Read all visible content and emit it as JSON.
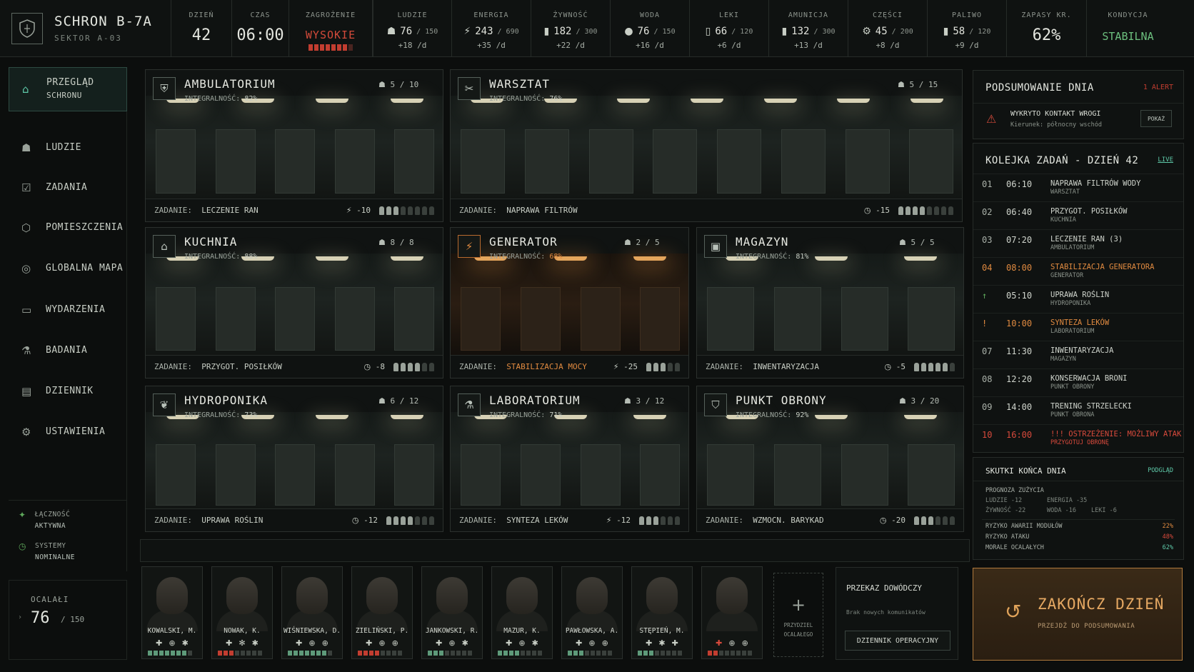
{
  "brand": {
    "title": "SCHRON B-7A",
    "sub": "SEKTOR A-03"
  },
  "top": {
    "day": {
      "label": "DZIEŃ",
      "value": "42"
    },
    "time": {
      "label": "CZAS",
      "value": "06:00"
    },
    "threat": {
      "label": "ZAGROŻENIE",
      "value": "WYSOKIE",
      "level": 7,
      "max": 8
    },
    "resources": [
      {
        "label": "LUDZIE",
        "icon": "people-icon",
        "value": "76",
        "max": "/ 150",
        "delta": "+18 /d"
      },
      {
        "label": "ENERGIA",
        "icon": "bolt-icon",
        "value": "243",
        "max": "/ 690",
        "delta": "+35 /d"
      },
      {
        "label": "ŻYWNOŚĆ",
        "icon": "food-icon",
        "value": "182",
        "max": "/ 300",
        "delta": "+22 /d"
      },
      {
        "label": "WODA",
        "icon": "water-icon",
        "value": "76",
        "max": "/ 150",
        "delta": "+16 /d"
      },
      {
        "label": "LEKI",
        "icon": "medicine-icon",
        "value": "66",
        "max": "/ 120",
        "delta": "+6 /d"
      },
      {
        "label": "AMUNICJA",
        "icon": "ammo-icon",
        "value": "132",
        "max": "/ 300",
        "delta": "+13 /d"
      },
      {
        "label": "CZĘŚCI",
        "icon": "gear-icon",
        "value": "45",
        "max": "/ 200",
        "delta": "+8 /d"
      },
      {
        "label": "PALIWO",
        "icon": "fuel-icon",
        "value": "58",
        "max": "/ 120",
        "delta": "+9 /d"
      }
    ],
    "supplies": {
      "label": "ZAPASY KR.",
      "value": "62%"
    },
    "condition": {
      "label": "KONDYCJA",
      "value": "STABILNA"
    }
  },
  "nav": [
    {
      "label": "PRZEGLĄD",
      "label2": "SCHRONU",
      "icon": "home-icon",
      "active": true
    },
    {
      "label": "LUDZIE",
      "icon": "people-icon"
    },
    {
      "label": "ZADANIA",
      "icon": "tasks-icon"
    },
    {
      "label": "POMIESZCZENIA",
      "icon": "rooms-icon"
    },
    {
      "label": "GLOBALNA MAPA",
      "icon": "globe-icon"
    },
    {
      "label": "WYDARZENIA",
      "icon": "book-icon"
    },
    {
      "label": "BADANIA",
      "icon": "flask-icon"
    },
    {
      "label": "DZIENNIK",
      "icon": "log-icon"
    },
    {
      "label": "USTAWIENIA",
      "icon": "settings-icon"
    }
  ],
  "status": [
    {
      "l1": "ŁĄCZNOŚĆ",
      "l2": "AKTYWNA"
    },
    {
      "l1": "SYSTEMY",
      "l2": "NOMINALNE"
    }
  ],
  "survivors": {
    "label": "OCALAŁI",
    "value": "76",
    "max": "/ 150"
  },
  "rooms": [
    {
      "name": "AMBULATORIUM",
      "integrity_label": "INTEGRALNOŚĆ:",
      "integrity": "82%",
      "crew": "5 / 10",
      "task_label": "ZADANIE:",
      "task": "LECZENIE RAN",
      "cost": "-10",
      "cost_icon": "bolt-icon",
      "pips": 3,
      "pips_max": 8
    },
    {
      "name": "WARSZTAT",
      "integrity_label": "INTEGRALNOŚĆ:",
      "integrity": "76%",
      "crew": "5 / 15",
      "task_label": "ZADANIE:",
      "task": "NAPRAWA FILTRÓW",
      "cost": "-15",
      "cost_icon": "clock-icon",
      "pips": 4,
      "pips_max": 8
    },
    {
      "name": "KUCHNIA",
      "integrity_label": "INTEGRALNOŚĆ:",
      "integrity": "88%",
      "crew": "8 / 8",
      "task_label": "ZADANIE:",
      "task": "PRZYGOT. POSIŁKÓW",
      "cost": "-8",
      "cost_icon": "clock-icon",
      "pips": 4,
      "pips_max": 6
    },
    {
      "name": "GENERATOR",
      "integrity_label": "INTEGRALNOŚĆ:",
      "integrity": "68%",
      "crew": "2 / 5",
      "task_label": "ZADANIE:",
      "task": "STABILIZACJA MOCY",
      "cost": "-25",
      "cost_icon": "bolt-icon",
      "pips": 3,
      "pips_max": 5
    },
    {
      "name": "MAGAZYN",
      "integrity_label": "INTEGRALNOŚĆ:",
      "integrity": "81%",
      "crew": "5 / 5",
      "task_label": "ZADANIE:",
      "task": "INWENTARYZACJA",
      "cost": "-5",
      "cost_icon": "clock-icon",
      "pips": 5,
      "pips_max": 6
    },
    {
      "name": "HYDROPONIKA",
      "integrity_label": "INTEGRALNOŚĆ:",
      "integrity": "73%",
      "crew": "6 / 12",
      "task_label": "ZADANIE:",
      "task": "UPRAWA ROŚLIN",
      "cost": "-12",
      "cost_icon": "clock-icon",
      "pips": 4,
      "pips_max": 7
    },
    {
      "name": "LABORATORIUM",
      "integrity_label": "INTEGRALNOŚĆ:",
      "integrity": "71%",
      "crew": "3 / 12",
      "task_label": "ZADANIE:",
      "task": "SYNTEZA LEKÓW",
      "cost": "-12",
      "cost_icon": "bolt-icon",
      "pips": 3,
      "pips_max": 6
    },
    {
      "name": "PUNKT OBRONY",
      "integrity_label": "INTEGRALNOŚĆ:",
      "integrity": "92%",
      "crew": "3 / 20",
      "task_label": "ZADANIE:",
      "task": "WZMOCN. BARYKAD",
      "cost": "-20",
      "cost_icon": "clock-icon",
      "pips": 3,
      "pips_max": 6
    }
  ],
  "summary": {
    "title": "PODSUMOWANIE DNIA",
    "alert": "1 ALERT",
    "alert_title": "WYKRYTO KONTAKT WROGI",
    "alert_sub": "Kierunek: północny wschód",
    "show_btn": "POKAŻ"
  },
  "queue": {
    "title": "KOLEJKA ZADAŃ - DZIEŃ 42",
    "live": "LIVE",
    "items": [
      {
        "n": "01",
        "t": "06:10",
        "name": "NAPRAWA FILTRÓW WODY",
        "sub": "WARSZTAT"
      },
      {
        "n": "02",
        "t": "06:40",
        "name": "PRZYGOT. POSIŁKÓW",
        "sub": "KUCHNIA"
      },
      {
        "n": "03",
        "t": "07:20",
        "name": "LECZENIE RAN (3)",
        "sub": "AMBULATORIUM"
      },
      {
        "n": "04",
        "t": "08:00",
        "name": "STABILIZACJA GENERATORA",
        "sub": "GENERATOR"
      },
      {
        "n": "↑",
        "t": "05:10",
        "name": "UPRAWA ROŚLIN",
        "sub": "HYDROPONIKA"
      },
      {
        "n": "!",
        "t": "10:00",
        "name": "SYNTEZA LEKÓW",
        "sub": "LABORATORIUM"
      },
      {
        "n": "07",
        "t": "11:30",
        "name": "INWENTARYZACJA",
        "sub": "MAGAZYN"
      },
      {
        "n": "08",
        "t": "12:20",
        "name": "KONSERWACJA BRONI",
        "sub": "PUNKT OBRONY"
      },
      {
        "n": "09",
        "t": "14:00",
        "name": "TRENING STRZELECKI",
        "sub": "PUNKT OBRONA"
      },
      {
        "n": "10",
        "t": "16:00",
        "name": "!!! OSTRZEŻENIE: MOŻLIWY ATAK",
        "sub": "PRZYGOTUJ OBRONĘ"
      }
    ]
  },
  "effects": {
    "title": "SKUTKI KOŃCA DNIA",
    "preview": "PODGLĄD",
    "forecast": "PROGNOZA ZUŻYCIA",
    "f1": "LUDZIE -12",
    "f2": "ENERGIA -35",
    "f3": "ŻYWNOŚĆ -22",
    "f4": "WODA -16",
    "f5": "LEKI -6",
    "risks": [
      {
        "label": "RYZYKO AWARII MODUŁÓW",
        "value": "22%"
      },
      {
        "label": "RYZYKO ATAKU",
        "value": "48%"
      },
      {
        "label": "MORALE OCALAŁYCH",
        "value": "62%"
      }
    ]
  },
  "people": [
    {
      "name": "KOWALSKI, M.",
      "health": 7,
      "bar": "g"
    },
    {
      "name": "NOWAK, K.",
      "health": 3,
      "bar": "r"
    },
    {
      "name": "WIŚNIEWSKA, D.",
      "health": 7,
      "bar": "g"
    },
    {
      "name": "ZIELIŃSKI, P.",
      "health": 4,
      "bar": "r"
    },
    {
      "name": "JANKOWSKI, R.",
      "health": 3,
      "bar": "g"
    },
    {
      "name": "MAZUR, K.",
      "health": 4,
      "bar": "g"
    },
    {
      "name": "PAWŁOWSKA, A.",
      "health": 3,
      "bar": "g"
    },
    {
      "name": "STĘPIEŃ, M.",
      "health": 3,
      "bar": "g"
    },
    {
      "name": "",
      "health": 2,
      "bar": "r"
    }
  ],
  "assign": {
    "l1": "PRZYDZIEL",
    "l2": "OCALAŁEGO"
  },
  "command": {
    "title": "PRZEKAZ DOWÓDCZY",
    "sub": "Brak nowych komunikatów",
    "btn": "DZIENNIK OPERACYJNY"
  },
  "endday": {
    "title": "ZAKOŃCZ DZIEŃ",
    "sub": "PRZEJDŹ DO PODSUMOWANIA"
  }
}
